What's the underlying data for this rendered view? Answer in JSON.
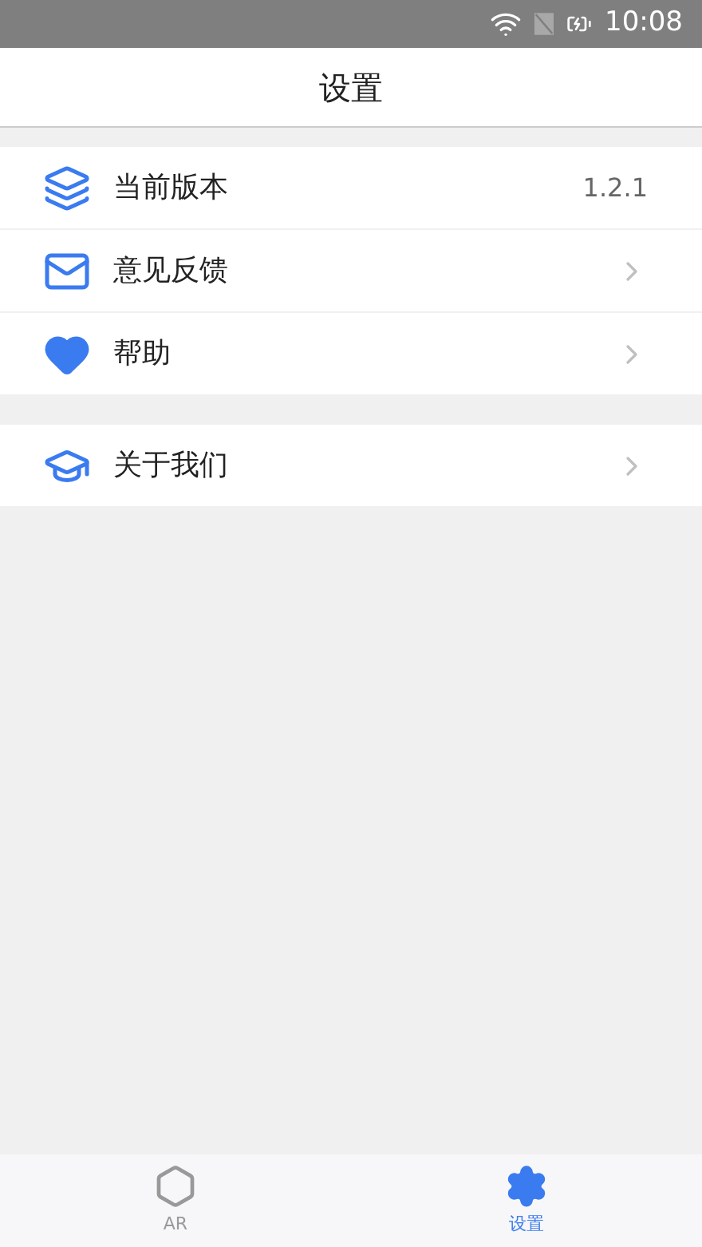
{
  "status_bar": {
    "time": "10:08"
  },
  "header": {
    "title": "设置"
  },
  "sections": [
    {
      "items": [
        {
          "label": "当前版本",
          "kind": "value",
          "value": "1.2.1"
        },
        {
          "label": "意见反馈",
          "kind": "link"
        },
        {
          "label": "帮助",
          "kind": "link"
        }
      ]
    },
    {
      "items": [
        {
          "label": "关于我们",
          "kind": "link"
        }
      ]
    }
  ],
  "tabs": [
    {
      "label": "AR",
      "selected": false
    },
    {
      "label": "设置",
      "selected": true
    }
  ]
}
